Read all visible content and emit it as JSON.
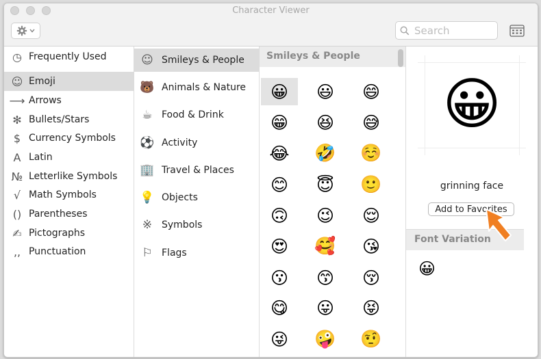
{
  "window": {
    "title": "Character Viewer"
  },
  "toolbar": {
    "settings_icon": "gear-icon",
    "search_placeholder": "Search",
    "keyboard_icon": "keyboard-viewer-icon"
  },
  "sidebar": {
    "items": [
      {
        "icon": "◷",
        "label": "Frequently Used"
      },
      {
        "icon": "☺",
        "label": "Emoji",
        "selected": true
      },
      {
        "icon": "⟶",
        "label": "Arrows"
      },
      {
        "icon": "✻",
        "label": "Bullets/Stars"
      },
      {
        "icon": "$",
        "label": "Currency Symbols"
      },
      {
        "icon": "A",
        "label": "Latin"
      },
      {
        "icon": "№",
        "label": "Letterlike Symbols"
      },
      {
        "icon": "√",
        "label": "Math Symbols"
      },
      {
        "icon": "()",
        "label": "Parentheses"
      },
      {
        "icon": "✍",
        "label": "Pictographs"
      },
      {
        "icon": "‚,",
        "label": "Punctuation"
      }
    ]
  },
  "categories": {
    "items": [
      {
        "icon": "☺",
        "label": "Smileys & People",
        "selected": true
      },
      {
        "icon": "🐻",
        "label": "Animals & Nature"
      },
      {
        "icon": "☕",
        "label": "Food & Drink"
      },
      {
        "icon": "⚽",
        "label": "Activity"
      },
      {
        "icon": "🏢",
        "label": "Travel & Places"
      },
      {
        "icon": "💡",
        "label": "Objects"
      },
      {
        "icon": "※",
        "label": "Symbols"
      },
      {
        "icon": "⚐",
        "label": "Flags"
      }
    ]
  },
  "grid": {
    "header": "Smileys & People",
    "emojis": [
      "😀",
      "😃",
      "😄",
      "😁",
      "😆",
      "😅",
      "😂",
      "🤣",
      "☺️",
      "😊",
      "😇",
      "🙂",
      "🙃",
      "😉",
      "😌",
      "😍",
      "🥰",
      "😘",
      "😗",
      "😙",
      "😚",
      "😋",
      "😛",
      "😝",
      "😜",
      "🤪",
      "🤨"
    ]
  },
  "preview": {
    "emoji": "😀",
    "name": "grinning face",
    "add_favorites_label": "Add to Favorites",
    "font_variation_header": "Font Variation",
    "font_variation_emoji": "😀"
  },
  "colors": {
    "selection": "#dcdcdc",
    "arrow": "#f07f22"
  }
}
